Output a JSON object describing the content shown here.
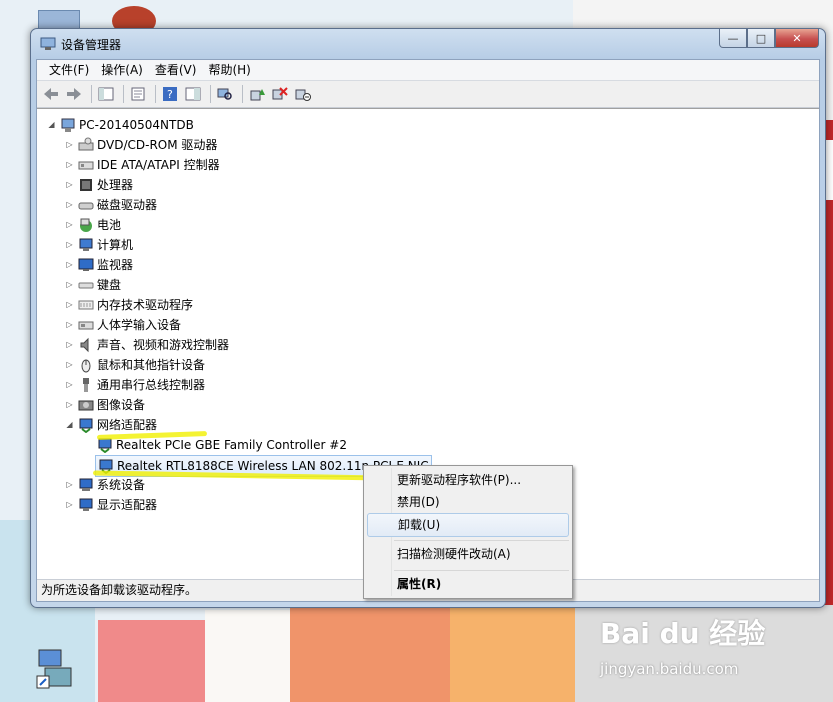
{
  "window": {
    "title": "设备管理器",
    "caption": {
      "minimize": "—",
      "maximize": "□",
      "close": "✕"
    }
  },
  "menu": [
    "文件(F)",
    "操作(A)",
    "查看(V)",
    "帮助(H)"
  ],
  "toolbar": [
    "back-icon",
    "forward-icon",
    "console-tree-icon",
    "properties-sheet-icon",
    "help-icon",
    "show-hide-icon",
    "scan-hardware-icon",
    "update-driver-icon",
    "uninstall-icon",
    "disable-icon"
  ],
  "tree": {
    "root": "PC-20140504NTDB",
    "items": [
      {
        "label": "DVD/CD-ROM 驱动器",
        "icon": "dvd-icon"
      },
      {
        "label": "IDE ATA/ATAPI 控制器",
        "icon": "ide-controller-icon"
      },
      {
        "label": "处理器",
        "icon": "processor-icon"
      },
      {
        "label": "磁盘驱动器",
        "icon": "disk-drive-icon"
      },
      {
        "label": "电池",
        "icon": "battery-icon"
      },
      {
        "label": "计算机",
        "icon": "computer-icon"
      },
      {
        "label": "监视器",
        "icon": "monitor-icon"
      },
      {
        "label": "键盘",
        "icon": "keyboard-icon"
      },
      {
        "label": "内存技术驱动程序",
        "icon": "memory-icon"
      },
      {
        "label": "人体学输入设备",
        "icon": "hid-icon"
      },
      {
        "label": "声音、视频和游戏控制器",
        "icon": "sound-icon"
      },
      {
        "label": "鼠标和其他指针设备",
        "icon": "mouse-icon"
      },
      {
        "label": "通用串行总线控制器",
        "icon": "usb-icon"
      },
      {
        "label": "图像设备",
        "icon": "camera-icon"
      },
      {
        "label": "网络适配器",
        "icon": "network-adapter-icon",
        "expanded": true
      },
      {
        "label": "系统设备",
        "icon": "system-device-icon"
      },
      {
        "label": "显示适配器",
        "icon": "display-adapter-icon"
      }
    ],
    "network_children": [
      "Realtek PCIe GBE Family Controller #2",
      "Realtek RTL8188CE Wireless LAN 802.11n PCI-E NIC"
    ]
  },
  "context_menu": {
    "items": [
      {
        "label": "更新驱动程序软件(P)..."
      },
      {
        "label": "禁用(D)"
      },
      {
        "label": "卸载(U)",
        "selected": true
      },
      {
        "label": "扫描检测硬件改动(A)"
      },
      {
        "label": "属性(R)",
        "bold": true
      }
    ]
  },
  "status": "为所选设备卸载该驱动程序。",
  "desktop": {
    "watermark": "Bai du 经验",
    "watermark_sub": "jingyan.baidu.com"
  }
}
